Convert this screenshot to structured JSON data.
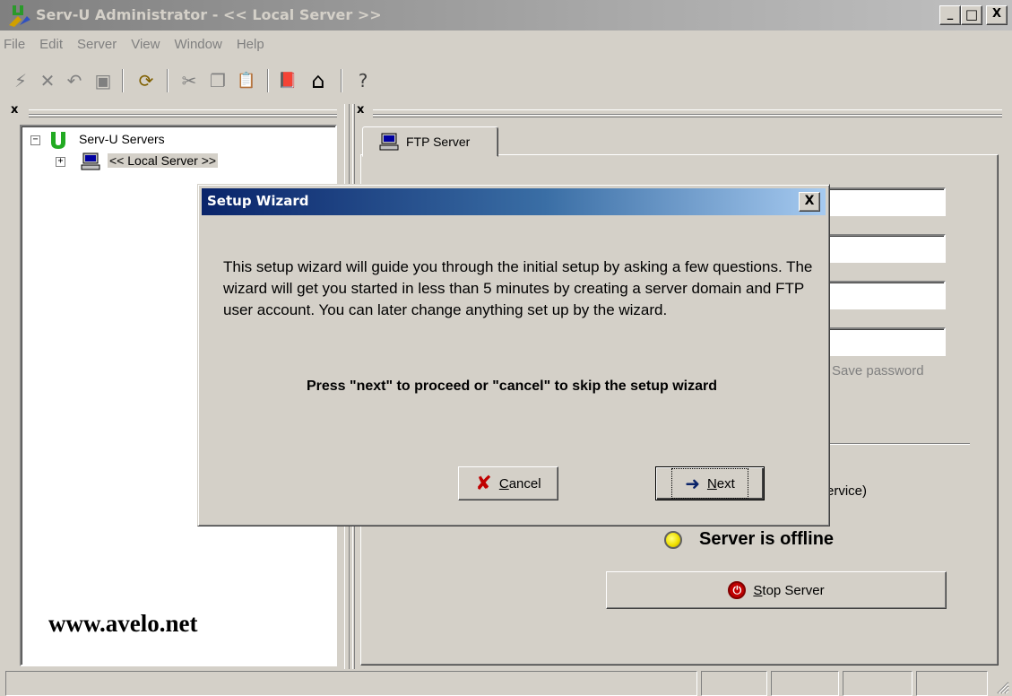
{
  "window": {
    "title": "Serv-U Administrator - << Local Server >>",
    "controls": {
      "minimize": "_",
      "maximize": "□",
      "close": "X"
    }
  },
  "menu": [
    "File",
    "Edit",
    "Server",
    "View",
    "Window",
    "Help"
  ],
  "toolbar": {
    "buttons": [
      {
        "name": "connect-icon",
        "glyph": "⚡"
      },
      {
        "name": "delete-icon",
        "glyph": "✕"
      },
      {
        "name": "undo-icon",
        "glyph": "↶"
      },
      {
        "name": "save-icon",
        "glyph": "▣"
      },
      {
        "name": "refresh-icon",
        "glyph": "⟳"
      },
      {
        "name": "cut-icon",
        "glyph": "✂"
      },
      {
        "name": "copy-icon",
        "glyph": "❐"
      },
      {
        "name": "paste-icon",
        "glyph": "📋"
      },
      {
        "name": "help-book-icon",
        "glyph": "📕"
      },
      {
        "name": "home-icon",
        "glyph": "⌂"
      },
      {
        "name": "about-icon",
        "glyph": "?"
      }
    ]
  },
  "panes": {
    "close_glyph": "x"
  },
  "tree": {
    "root": {
      "label": "Serv-U Servers",
      "expander": "−"
    },
    "child": {
      "label": "<< Local Server >>",
      "expander": "+"
    }
  },
  "watermark": "www.avelo.net",
  "server_panel": {
    "tab_label": "FTP Server",
    "save_password_label": "Save password",
    "service_label": "ervice)",
    "status_text": "Server is offline",
    "status_color": "#f0e000",
    "stop_button": {
      "label": "Stop Server",
      "icon": "stop-icon"
    }
  },
  "dialog": {
    "title": "Setup Wizard",
    "close_glyph": "X",
    "message": "This setup wizard will guide you through the initial setup by asking a few questions. The wizard will get you started in less than 5 minutes by creating a server domain and FTP user account. You can later change anything set up by the wizard.",
    "prompt": "Press \"next\" to proceed or \"cancel\" to skip the setup wizard",
    "cancel_button": {
      "label": "Cancel",
      "icon": "x-icon",
      "icon_color": "#c00000"
    },
    "next_button": {
      "label": "Next",
      "icon": "arrow-right-icon",
      "icon_color": "#0a246a"
    }
  }
}
